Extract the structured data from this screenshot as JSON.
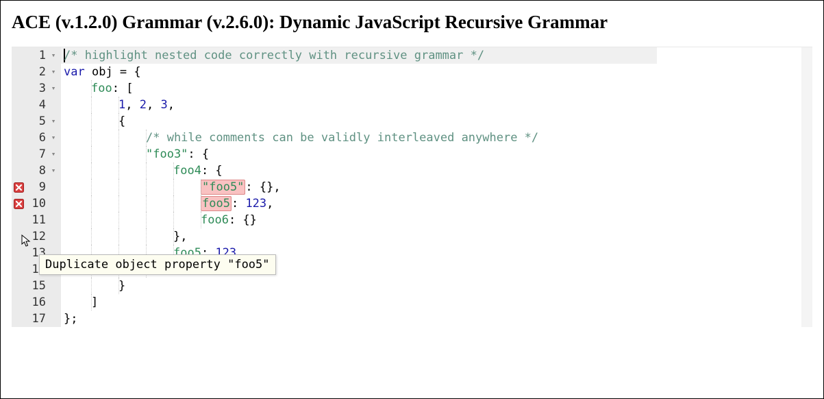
{
  "title": "ACE (v.1.2.0) Grammar (v.2.6.0): Dynamic JavaScript Recursive Grammar",
  "tooltip_text": "Duplicate object property \"foo5\"",
  "editor": {
    "active_line": 1,
    "lines": [
      {
        "n": 1,
        "fold": true,
        "error": false,
        "indent": 0,
        "tokens": [
          {
            "t": "comment",
            "v": "/* highlight nested code correctly with recursive grammar */"
          }
        ]
      },
      {
        "n": 2,
        "fold": true,
        "error": false,
        "indent": 0,
        "tokens": [
          {
            "t": "keyword",
            "v": "var"
          },
          {
            "t": "punct",
            "v": " "
          },
          {
            "t": "ident",
            "v": "obj"
          },
          {
            "t": "punct",
            "v": " = {"
          }
        ]
      },
      {
        "n": 3,
        "fold": true,
        "error": false,
        "indent": 1,
        "tokens": [
          {
            "t": "prop",
            "v": "foo"
          },
          {
            "t": "punct",
            "v": ": ["
          }
        ]
      },
      {
        "n": 4,
        "fold": false,
        "error": false,
        "indent": 2,
        "tokens": [
          {
            "t": "num",
            "v": "1"
          },
          {
            "t": "punct",
            "v": ", "
          },
          {
            "t": "num",
            "v": "2"
          },
          {
            "t": "punct",
            "v": ", "
          },
          {
            "t": "num",
            "v": "3"
          },
          {
            "t": "punct",
            "v": ","
          }
        ]
      },
      {
        "n": 5,
        "fold": true,
        "error": false,
        "indent": 2,
        "tokens": [
          {
            "t": "punct",
            "v": "{"
          }
        ]
      },
      {
        "n": 6,
        "fold": true,
        "error": false,
        "indent": 3,
        "tokens": [
          {
            "t": "comment",
            "v": "/* while comments can be validly interleaved anywhere */"
          }
        ]
      },
      {
        "n": 7,
        "fold": true,
        "error": false,
        "indent": 3,
        "tokens": [
          {
            "t": "string",
            "v": "\"foo3\""
          },
          {
            "t": "punct",
            "v": ": {"
          }
        ]
      },
      {
        "n": 8,
        "fold": true,
        "error": false,
        "indent": 4,
        "tokens": [
          {
            "t": "prop",
            "v": "foo4"
          },
          {
            "t": "punct",
            "v": ": {"
          }
        ]
      },
      {
        "n": 9,
        "fold": false,
        "error": true,
        "indent": 5,
        "tokens": [
          {
            "t": "string",
            "v": "\"foo5\"",
            "hl": true
          },
          {
            "t": "punct",
            "v": ": {},"
          }
        ]
      },
      {
        "n": 10,
        "fold": false,
        "error": true,
        "indent": 5,
        "tokens": [
          {
            "t": "prop",
            "v": "foo5",
            "hl": true
          },
          {
            "t": "punct",
            "v": ": "
          },
          {
            "t": "num",
            "v": "123"
          },
          {
            "t": "punct",
            "v": ","
          }
        ]
      },
      {
        "n": 11,
        "fold": false,
        "error": false,
        "indent": 5,
        "tokens": [
          {
            "t": "prop",
            "v": "foo6"
          },
          {
            "t": "punct",
            "v": ": {}"
          }
        ]
      },
      {
        "n": 12,
        "fold": false,
        "error": false,
        "indent": 4,
        "tokens": [
          {
            "t": "punct",
            "v": "},"
          }
        ]
      },
      {
        "n": 13,
        "fold": false,
        "error": false,
        "indent": 4,
        "tokens": [
          {
            "t": "prop",
            "v": "foo5"
          },
          {
            "t": "punct",
            "v": ": "
          },
          {
            "t": "num",
            "v": "123"
          }
        ]
      },
      {
        "n": 14,
        "fold": false,
        "error": false,
        "indent": 3,
        "tokens": [
          {
            "t": "punct",
            "v": "}"
          }
        ]
      },
      {
        "n": 15,
        "fold": false,
        "error": false,
        "indent": 2,
        "tokens": [
          {
            "t": "punct",
            "v": "}"
          }
        ]
      },
      {
        "n": 16,
        "fold": false,
        "error": false,
        "indent": 1,
        "tokens": [
          {
            "t": "punct",
            "v": "]"
          }
        ]
      },
      {
        "n": 17,
        "fold": false,
        "error": false,
        "indent": 0,
        "tokens": [
          {
            "t": "punct",
            "v": "};"
          }
        ]
      }
    ]
  }
}
